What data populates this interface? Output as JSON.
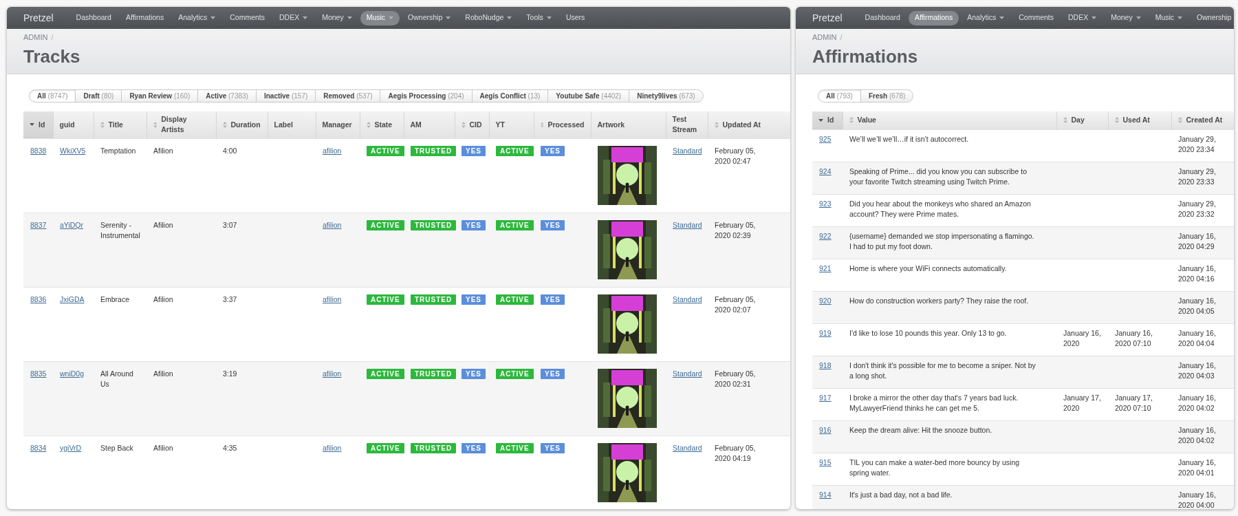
{
  "tracks_window": {
    "brand": "Pretzel",
    "nav": [
      {
        "label": "Dashboard",
        "dropdown": false,
        "selected": false
      },
      {
        "label": "Affirmations",
        "dropdown": false,
        "selected": false
      },
      {
        "label": "Analytics",
        "dropdown": true,
        "selected": false
      },
      {
        "label": "Comments",
        "dropdown": false,
        "selected": false
      },
      {
        "label": "DDEX",
        "dropdown": true,
        "selected": false
      },
      {
        "label": "Money",
        "dropdown": true,
        "selected": false
      },
      {
        "label": "Music",
        "dropdown": true,
        "selected": true
      },
      {
        "label": "Ownership",
        "dropdown": true,
        "selected": false
      },
      {
        "label": "RoboNudge",
        "dropdown": true,
        "selected": false
      },
      {
        "label": "Tools",
        "dropdown": true,
        "selected": false
      },
      {
        "label": "Users",
        "dropdown": false,
        "selected": false
      }
    ],
    "breadcrumb": {
      "label": "ADMIN",
      "separator": "/"
    },
    "title": "Tracks",
    "filters": [
      {
        "label": "All",
        "count": "(8747)",
        "selected": true
      },
      {
        "label": "Draft",
        "count": "(80)",
        "selected": false
      },
      {
        "label": "Ryan Review",
        "count": "(160)",
        "selected": false
      },
      {
        "label": "Active",
        "count": "(7383)",
        "selected": false
      },
      {
        "label": "Inactive",
        "count": "(157)",
        "selected": false
      },
      {
        "label": "Removed",
        "count": "(537)",
        "selected": false
      },
      {
        "label": "Aegis Processing",
        "count": "(204)",
        "selected": false
      },
      {
        "label": "Aegis Conflict",
        "count": "(13)",
        "selected": false
      },
      {
        "label": "Youtube Safe",
        "count": "(4402)",
        "selected": false
      },
      {
        "label": "Ninety9lives",
        "count": "(673)",
        "selected": false
      }
    ],
    "columns": [
      {
        "label": "Id",
        "sortable": true,
        "sorted": true
      },
      {
        "label": "guid",
        "sortable": false,
        "sorted": false
      },
      {
        "label": "Title",
        "sortable": true,
        "sorted": false
      },
      {
        "label": "Display Artists",
        "sortable": true,
        "sorted": false
      },
      {
        "label": "Duration",
        "sortable": true,
        "sorted": false
      },
      {
        "label": "Label",
        "sortable": false,
        "sorted": false
      },
      {
        "label": "Manager",
        "sortable": false,
        "sorted": false
      },
      {
        "label": "State",
        "sortable": true,
        "sorted": false
      },
      {
        "label": "AM",
        "sortable": false,
        "sorted": false
      },
      {
        "label": "CID",
        "sortable": true,
        "sorted": false
      },
      {
        "label": "YT",
        "sortable": false,
        "sorted": false
      },
      {
        "label": "Processed",
        "sortable": true,
        "sorted": false
      },
      {
        "label": "Artwork",
        "sortable": false,
        "sorted": false
      },
      {
        "label": "Test Stream",
        "sortable": false,
        "sorted": false
      },
      {
        "label": "Updated At",
        "sortable": true,
        "sorted": false
      }
    ],
    "rows": [
      {
        "id": "8838",
        "guid": "WkiXV5",
        "title": "Temptation",
        "display_artists": "Afilion",
        "duration": "4:00",
        "manager": "afilion",
        "state": {
          "text": "ACTIVE",
          "color": "#2db83d"
        },
        "am": {
          "text": "TRUSTED",
          "color": "#2db83d"
        },
        "cid": {
          "text": "YES",
          "color": "#5b8edb"
        },
        "yt": {
          "text": "ACTIVE",
          "color": "#2db83d"
        },
        "processed": {
          "text": "YES",
          "color": "#5b8edb"
        },
        "test_stream": "Standard",
        "updated_at": "February 05, 2020 02:47"
      },
      {
        "id": "8837",
        "guid": "aYiDQr",
        "title": "Serenity - Instrumental",
        "display_artists": "Afilion",
        "duration": "3:07",
        "manager": "afilion",
        "state": {
          "text": "ACTIVE",
          "color": "#2db83d"
        },
        "am": {
          "text": "TRUSTED",
          "color": "#2db83d"
        },
        "cid": {
          "text": "YES",
          "color": "#5b8edb"
        },
        "yt": {
          "text": "ACTIVE",
          "color": "#2db83d"
        },
        "processed": {
          "text": "YES",
          "color": "#5b8edb"
        },
        "test_stream": "Standard",
        "updated_at": "February 05, 2020 02:39"
      },
      {
        "id": "8836",
        "guid": "JxiGDA",
        "title": "Embrace",
        "display_artists": "Afilion",
        "duration": "3:37",
        "manager": "afilion",
        "state": {
          "text": "ACTIVE",
          "color": "#2db83d"
        },
        "am": {
          "text": "TRUSTED",
          "color": "#2db83d"
        },
        "cid": {
          "text": "YES",
          "color": "#5b8edb"
        },
        "yt": {
          "text": "ACTIVE",
          "color": "#2db83d"
        },
        "processed": {
          "text": "YES",
          "color": "#5b8edb"
        },
        "test_stream": "Standard",
        "updated_at": "February 05, 2020 02:07"
      },
      {
        "id": "8835",
        "guid": "wniD0g",
        "title": "All Around Us",
        "display_artists": "Afilion",
        "duration": "3:19",
        "manager": "afilion",
        "state": {
          "text": "ACTIVE",
          "color": "#2db83d"
        },
        "am": {
          "text": "TRUSTED",
          "color": "#2db83d"
        },
        "cid": {
          "text": "YES",
          "color": "#5b8edb"
        },
        "yt": {
          "text": "ACTIVE",
          "color": "#2db83d"
        },
        "processed": {
          "text": "YES",
          "color": "#5b8edb"
        },
        "test_stream": "Standard",
        "updated_at": "February 05, 2020 02:31"
      },
      {
        "id": "8834",
        "guid": "ygiVrD",
        "title": "Step Back",
        "display_artists": "Afilion",
        "duration": "4:35",
        "manager": "afilion",
        "state": {
          "text": "ACTIVE",
          "color": "#2db83d"
        },
        "am": {
          "text": "TRUSTED",
          "color": "#2db83d"
        },
        "cid": {
          "text": "YES",
          "color": "#5b8edb"
        },
        "yt": {
          "text": "ACTIVE",
          "color": "#2db83d"
        },
        "processed": {
          "text": "YES",
          "color": "#5b8edb"
        },
        "test_stream": "Standard",
        "updated_at": "February 05, 2020 04:19"
      }
    ]
  },
  "affirmations_window": {
    "brand": "Pretzel",
    "nav": [
      {
        "label": "Dashboard",
        "dropdown": false,
        "selected": false
      },
      {
        "label": "Affirmations",
        "dropdown": false,
        "selected": true
      },
      {
        "label": "Analytics",
        "dropdown": true,
        "selected": false
      },
      {
        "label": "Comments",
        "dropdown": false,
        "selected": false
      },
      {
        "label": "DDEX",
        "dropdown": true,
        "selected": false
      },
      {
        "label": "Money",
        "dropdown": true,
        "selected": false
      },
      {
        "label": "Music",
        "dropdown": true,
        "selected": false
      },
      {
        "label": "Ownership",
        "dropdown": false,
        "selected": false
      }
    ],
    "breadcrumb": {
      "label": "ADMIN",
      "separator": "/"
    },
    "title": "Affirmations",
    "filters": [
      {
        "label": "All",
        "count": "(793)",
        "selected": true
      },
      {
        "label": "Fresh",
        "count": "(678)",
        "selected": false
      }
    ],
    "columns": [
      {
        "label": "Id",
        "sortable": true,
        "sorted": true
      },
      {
        "label": "Value",
        "sortable": true,
        "sorted": false
      },
      {
        "label": "Day",
        "sortable": true,
        "sorted": false
      },
      {
        "label": "Used At",
        "sortable": true,
        "sorted": false
      },
      {
        "label": "Created At",
        "sortable": true,
        "sorted": false
      }
    ],
    "rows": [
      {
        "id": "925",
        "value": "We’ll we’ll we’ll…if it isn’t autocorrect.",
        "created_at": "January 29, 2020 23:34"
      },
      {
        "id": "924",
        "value": "Speaking of Prime... did you know you can subscribe to your favorite Twitch streaming using Twitch Prime.",
        "created_at": "January 29, 2020 23:33"
      },
      {
        "id": "923",
        "value": "Did you hear about the monkeys who shared an Amazon account? They were Prime mates.",
        "created_at": "January 29, 2020 23:32"
      },
      {
        "id": "922",
        "value": "{username} demanded we stop impersonating a flamingo. I had to put my foot down.",
        "created_at": "January 16, 2020 04:29"
      },
      {
        "id": "921",
        "value": "Home is where your WiFi connects automatically.",
        "created_at": "January 16, 2020 04:16"
      },
      {
        "id": "920",
        "value": "How do construction workers party? They raise the roof.",
        "created_at": "January 16, 2020 04:05"
      },
      {
        "id": "919",
        "value": "I'd like to lose 10 pounds this year. Only 13 to go.",
        "day": "January 16, 2020",
        "used_at": "January 16, 2020 07:10",
        "created_at": "January 16, 2020 04:04"
      },
      {
        "id": "918",
        "value": "I don't think it's possible for me to become a sniper. Not by a long shot.",
        "created_at": "January 16, 2020 04:03"
      },
      {
        "id": "917",
        "value": "I broke a mirror the other day that's 7 years bad luck. MyLawyerFriend thinks he can get me 5.",
        "day": "January 17, 2020",
        "used_at": "January 17, 2020 07:10",
        "created_at": "January 16, 2020 04:02"
      },
      {
        "id": "916",
        "value": "Keep the dream alive: Hit the snooze button.",
        "created_at": "January 16, 2020 04:02"
      },
      {
        "id": "915",
        "value": "TIL you can make a water-bed more bouncy by using spring water.",
        "created_at": "January 16, 2020 04:01"
      },
      {
        "id": "914",
        "value": "It's just a bad day, not a bad life.",
        "created_at": "January 16, 2020 04:00"
      }
    ]
  }
}
